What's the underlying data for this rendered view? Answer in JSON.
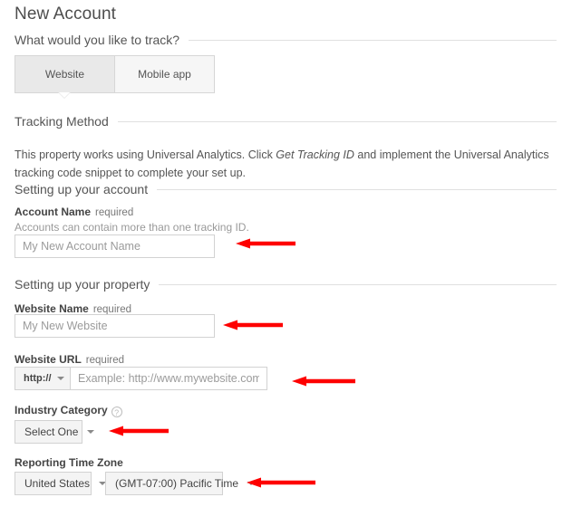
{
  "page": {
    "title": "New Account"
  },
  "track_section": {
    "heading": "What would you like to track?",
    "tabs": [
      {
        "label": "Website",
        "selected": true
      },
      {
        "label": "Mobile app",
        "selected": false
      }
    ]
  },
  "tracking_method": {
    "heading": "Tracking Method",
    "paragraph_part1": "This property works using Universal Analytics. Click ",
    "paragraph_emphasis": "Get Tracking ID",
    "paragraph_part2": " and implement the Universal Analytics tracking code snippet to complete your set up."
  },
  "account_section": {
    "heading": "Setting up your account",
    "account_name": {
      "label": "Account Name",
      "required": "required",
      "hint": "Accounts can contain more than one tracking ID.",
      "placeholder": "My New Account Name",
      "value": ""
    }
  },
  "property_section": {
    "heading": "Setting up your property",
    "website_name": {
      "label": "Website Name",
      "required": "required",
      "placeholder": "My New Website",
      "value": ""
    },
    "website_url": {
      "label": "Website URL",
      "required": "required",
      "protocol": "http://",
      "placeholder": "Example: http://www.mywebsite.com",
      "value": ""
    },
    "industry_category": {
      "label": "Industry Category",
      "help_icon": "help-question-icon",
      "selected": "Select One"
    },
    "reporting_time_zone": {
      "label": "Reporting Time Zone",
      "country_selected": "United States",
      "zone_selected": "(GMT-07:00) Pacific Time"
    }
  },
  "annotations": {
    "arrow_color": "#fe0000",
    "arrows": [
      {
        "name": "arrow-account-name",
        "points_to": "account-name-input"
      },
      {
        "name": "arrow-website-name",
        "points_to": "website-name-input"
      },
      {
        "name": "arrow-website-url",
        "points_to": "website-url-input"
      },
      {
        "name": "arrow-industry-category",
        "points_to": "industry-category-select"
      },
      {
        "name": "arrow-time-zone",
        "points_to": "time-zone-select"
      }
    ]
  },
  "colors": {
    "text": "#444444",
    "muted": "#999999",
    "rule": "#e0e0e0",
    "input_border": "#d2d2d2",
    "tab_selected_bg": "#e9e9e9",
    "tab_bg": "#f6f6f6"
  }
}
